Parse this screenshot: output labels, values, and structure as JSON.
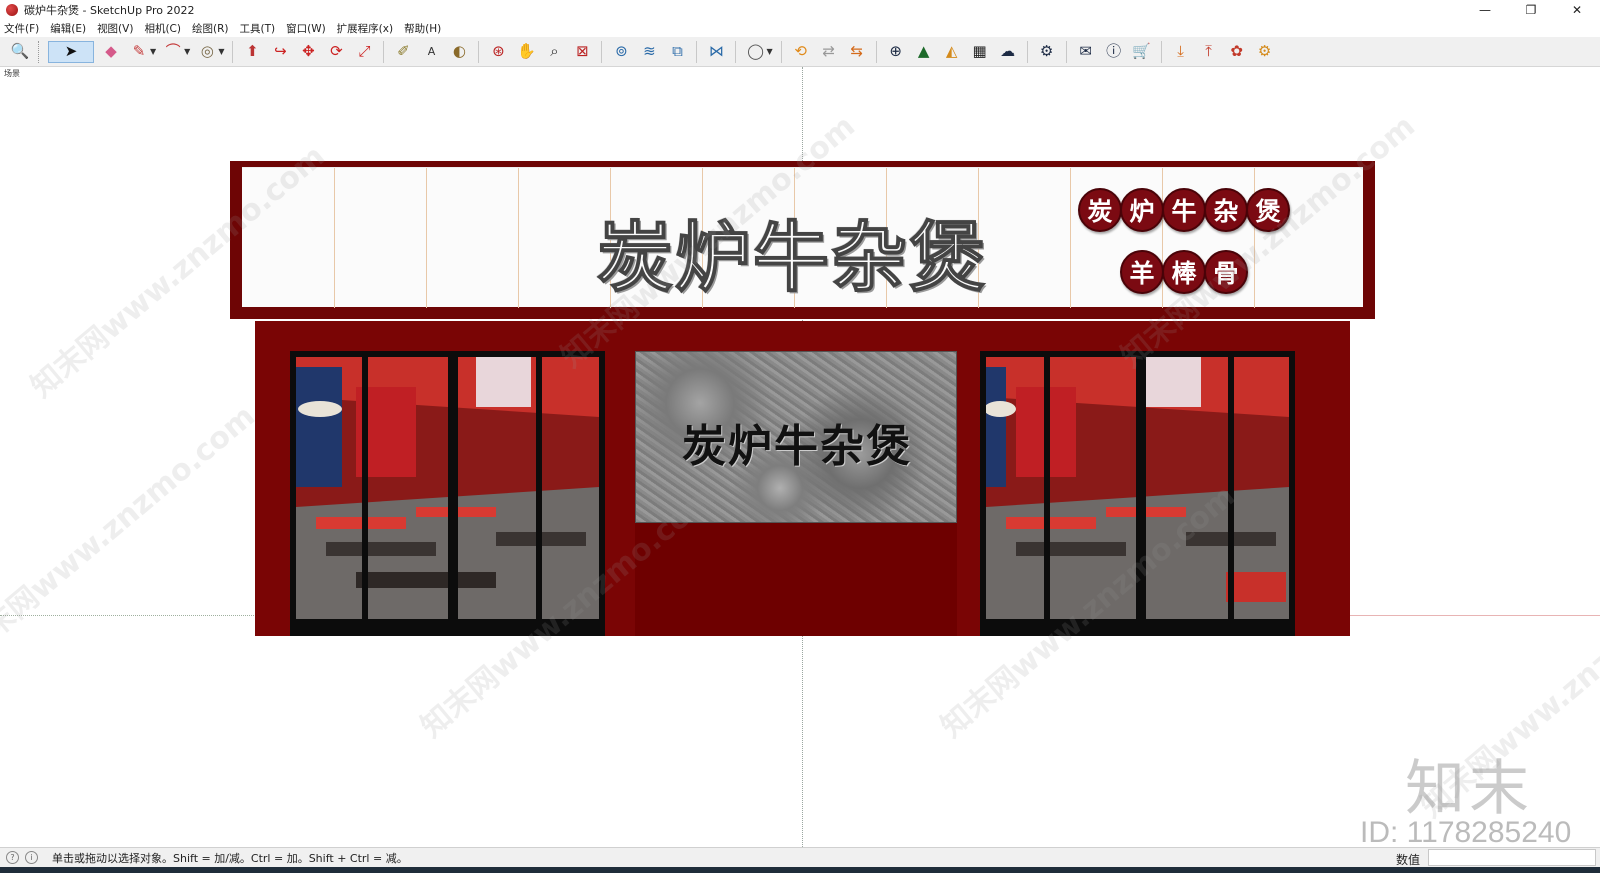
{
  "window": {
    "title": "碳炉牛杂煲 - SketchUp Pro 2022",
    "minimize": "—",
    "restore": "❐",
    "close": "✕"
  },
  "menu": [
    "文件(F)",
    "编辑(E)",
    "视图(V)",
    "相机(C)",
    "绘图(R)",
    "工具(T)",
    "窗口(W)",
    "扩展程序(x)",
    "帮助(H)"
  ],
  "toolbar": {
    "tools": [
      {
        "name": "zoom-extents-icon",
        "glyph": "🔍"
      },
      {
        "name": "select-icon",
        "glyph": "➤"
      },
      {
        "name": "eraser-icon",
        "glyph": "◆"
      },
      {
        "name": "pencil-icon",
        "glyph": "✎"
      },
      {
        "name": "arc-icon",
        "glyph": "⌒"
      },
      {
        "name": "shape-icon",
        "glyph": "◎"
      },
      {
        "name": "push-pull-icon",
        "glyph": "⬆"
      },
      {
        "name": "follow-me-icon",
        "glyph": "↪"
      },
      {
        "name": "move-icon",
        "glyph": "✥"
      },
      {
        "name": "rotate-icon",
        "glyph": "⟳"
      },
      {
        "name": "scale-icon",
        "glyph": "⤢"
      },
      {
        "name": "tape-measure-icon",
        "glyph": "✐"
      },
      {
        "name": "text-icon",
        "glyph": "A"
      },
      {
        "name": "paint-bucket-icon",
        "glyph": "◐"
      },
      {
        "name": "orbit-icon",
        "glyph": "⊛"
      },
      {
        "name": "pan-icon",
        "glyph": "✋"
      },
      {
        "name": "zoom-icon",
        "glyph": "⌕"
      },
      {
        "name": "zoom-window-icon",
        "glyph": "⊠"
      },
      {
        "name": "section-plane-icon",
        "glyph": "⊚"
      },
      {
        "name": "layers-icon",
        "glyph": "≋"
      },
      {
        "name": "styles-icon",
        "glyph": "⧉"
      },
      {
        "name": "components-icon",
        "glyph": "⋈"
      },
      {
        "name": "account-icon",
        "glyph": "◯"
      },
      {
        "name": "warehouse-icon",
        "glyph": "⟲"
      },
      {
        "name": "sync-icon",
        "glyph": "⇄"
      },
      {
        "name": "scene-icon",
        "glyph": "⇆"
      },
      {
        "name": "add-icon",
        "glyph": "⊕"
      },
      {
        "name": "tree-icon",
        "glyph": "▲"
      },
      {
        "name": "terrain-icon",
        "glyph": "◭"
      },
      {
        "name": "checker-icon",
        "glyph": "▦"
      },
      {
        "name": "cloud-upload-icon",
        "glyph": "☁"
      },
      {
        "name": "settings-icon",
        "glyph": "⚙"
      },
      {
        "name": "mail-icon",
        "glyph": "✉"
      },
      {
        "name": "info-icon",
        "glyph": "ⓘ"
      },
      {
        "name": "cart-icon",
        "glyph": "🛒"
      },
      {
        "name": "import-icon",
        "glyph": "⤓"
      },
      {
        "name": "export-icon",
        "glyph": "⤒"
      },
      {
        "name": "render-icon",
        "glyph": "✿"
      },
      {
        "name": "gears-icon",
        "glyph": "⚙"
      }
    ]
  },
  "scene_tab": "场景",
  "storefront": {
    "sign_title": "炭炉牛杂煲",
    "badge_row1": [
      "炭",
      "炉",
      "牛",
      "杂",
      "煲"
    ],
    "badge_row2": [
      "羊",
      "棒",
      "骨"
    ],
    "stone_text": "炭炉牛杂煲"
  },
  "watermark": {
    "text": "知末网www.znzmo.com",
    "brand": "知末",
    "id": "ID: 1178285240"
  },
  "status": {
    "message": "单击或拖动以选择对象。Shift = 加/减。Ctrl = 加。Shift + Ctrl = 减。",
    "measurements_label": "数值"
  },
  "colors": {
    "facade_red": "#7a0505",
    "badge_red": "#7b0a12",
    "sign_white": "#fbfbfb"
  }
}
